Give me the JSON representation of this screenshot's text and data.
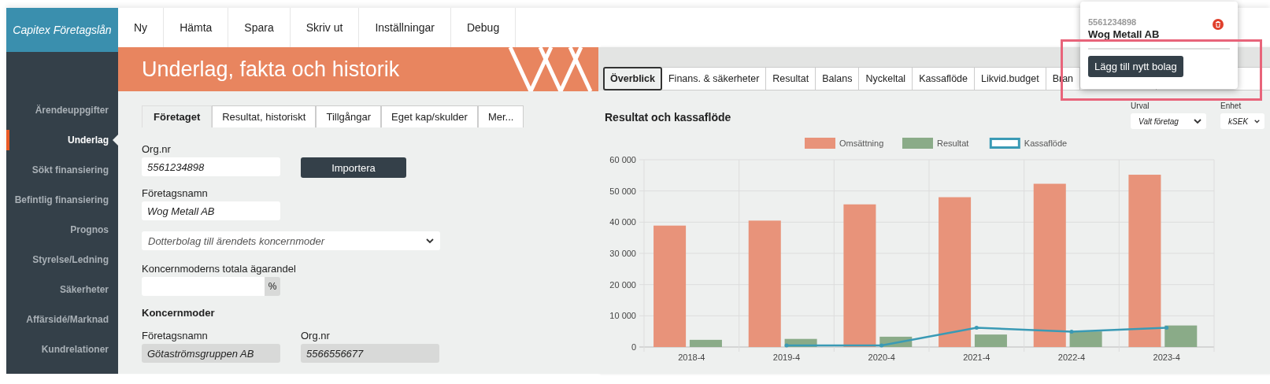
{
  "logo": "Capitex Företagslån",
  "top_menu": [
    "Ny",
    "Hämta",
    "Spara",
    "Skriv ut",
    "Inställningar",
    "Debug"
  ],
  "sidebar": {
    "items": [
      {
        "label": "Ärendeuppgifter",
        "selected": false
      },
      {
        "label": "Underlag",
        "selected": true
      },
      {
        "label": "Sökt finansiering",
        "selected": false
      },
      {
        "label": "Befintlig finansiering",
        "selected": false
      },
      {
        "label": "Prognos",
        "selected": false
      },
      {
        "label": "Styrelse/Ledning",
        "selected": false
      },
      {
        "label": "Säkerheter",
        "selected": false
      },
      {
        "label": "Affärsidé/Marknad",
        "selected": false
      },
      {
        "label": "Kundrelationer",
        "selected": false
      }
    ]
  },
  "page_title": "Underlag, fakta och historik",
  "form_tabs": [
    {
      "label": "Företaget",
      "selected": true
    },
    {
      "label": "Resultat, historiskt",
      "selected": false
    },
    {
      "label": "Tillgångar",
      "selected": false
    },
    {
      "label": "Eget kap/skulder",
      "selected": false
    },
    {
      "label": "Mer...",
      "selected": false
    }
  ],
  "form": {
    "org_nr": {
      "label": "Org.nr",
      "value": "5561234898"
    },
    "import_button": "Importera",
    "company_name": {
      "label": "Företagsnamn",
      "value": "Wog Metall AB"
    },
    "relation_select": {
      "value": "Dotterbolag till ärendets koncernmoder"
    },
    "ownership": {
      "label": "Koncernmoderns totala ägarandel",
      "unit": "%"
    },
    "parent_heading": "Koncernmoder",
    "parent_name": {
      "label": "Företagsnamn",
      "value": "Götaströmsgruppen AB"
    },
    "parent_org_nr": {
      "label": "Org.nr",
      "value": "5566556677"
    }
  },
  "overview_tabs": [
    {
      "label": "Överblick",
      "selected": true
    },
    {
      "label": "Finans. & säkerheter",
      "selected": false
    },
    {
      "label": "Resultat",
      "selected": false
    },
    {
      "label": "Balans",
      "selected": false
    },
    {
      "label": "Nyckeltal",
      "selected": false
    },
    {
      "label": "Kassaflöde",
      "selected": false
    },
    {
      "label": "Likvid.budget",
      "selected": false
    },
    {
      "label": "Bran",
      "selected": false
    }
  ],
  "chart_panel": {
    "title": "Resultat och kassaflöde",
    "selection": {
      "label": "Urval",
      "value": "Valt företag"
    },
    "unit": {
      "label": "Enhet",
      "value": "kSEK"
    },
    "chart_data": {
      "type": "bar",
      "categories": [
        "2018-4",
        "2019-4",
        "2020-4",
        "2021-4",
        "2022-4",
        "2023-4"
      ],
      "ylim": [
        0,
        60000
      ],
      "stacked": false,
      "grid": true,
      "legend": true,
      "yticks": [
        {
          "value": 0,
          "label": "0"
        },
        {
          "value": 10000,
          "label": "10 000"
        },
        {
          "value": 20000,
          "label": "20 000"
        },
        {
          "value": 30000,
          "label": "30 000"
        },
        {
          "value": 40000,
          "label": "40 000"
        },
        {
          "value": 50000,
          "label": "50 000"
        },
        {
          "value": 60000,
          "label": "60 000"
        }
      ],
      "series": [
        {
          "name": "Omsättning",
          "color": "#e8937a",
          "values": [
            38900,
            40500,
            45700,
            48000,
            52300,
            55200
          ]
        },
        {
          "name": "Resultat",
          "color": "#8aab88",
          "values": [
            2300,
            2600,
            3300,
            4000,
            5000,
            6900
          ]
        },
        {
          "name": "Kassaflöde",
          "color": "#3a9ab5",
          "type": "line",
          "values": [
            null,
            500,
            500,
            6200,
            4900,
            6200
          ]
        }
      ]
    }
  },
  "company_popup": {
    "org_nr": "5561234898",
    "name": "Wog Metall AB",
    "add_button": "Lägg till nytt bolag"
  }
}
